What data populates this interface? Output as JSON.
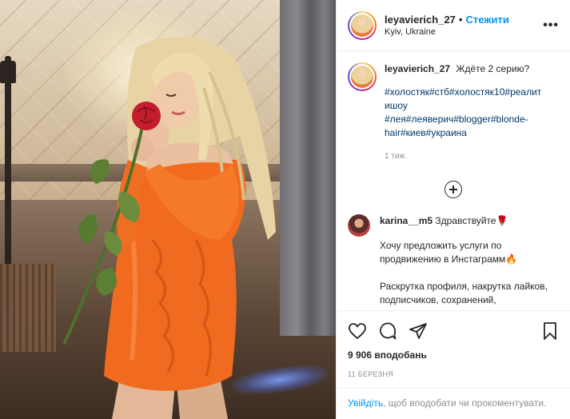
{
  "post": {
    "author": {
      "username": "leyavierich_27",
      "follow_label": "Стежити",
      "location": "Kyiv, Ukraine",
      "more_label": "•••"
    },
    "caption": {
      "text": "Ждёте 2 серию?",
      "hashtag_lines": [
        "#холостяк#стб#холостяк10#реалит",
        "ишоу",
        "#лея#леяверич#blogger#blonde-",
        "hair#киев#украина"
      ],
      "time_ago": "1 тиж."
    },
    "comments": [
      {
        "username": "karina__m5",
        "first_line": "Здравствуйте🌹",
        "paragraphs": [
          "Хочу предложить услуги по продвижению в Инстаграмм🔥",
          "Раскрутка профиля, накрутка лайков, подписчиков, сохранений,"
        ]
      }
    ],
    "likes": "9 906 вподобань",
    "date": "11 БЕРЕЗНЯ",
    "login_prompt": {
      "link": "Увійдіть",
      "rest": ", щоб вподобати чи прокоментувати."
    }
  },
  "colors": {
    "accent": "#0095f6",
    "hashtag": "#00376b",
    "text": "#262626",
    "muted": "#8e8e8e",
    "dress": "#f06a1f",
    "rose": "#c41e2e"
  },
  "icons": [
    "heart-icon",
    "comment-icon",
    "share-icon",
    "bookmark-icon",
    "plus-circle-icon",
    "more-icon"
  ]
}
